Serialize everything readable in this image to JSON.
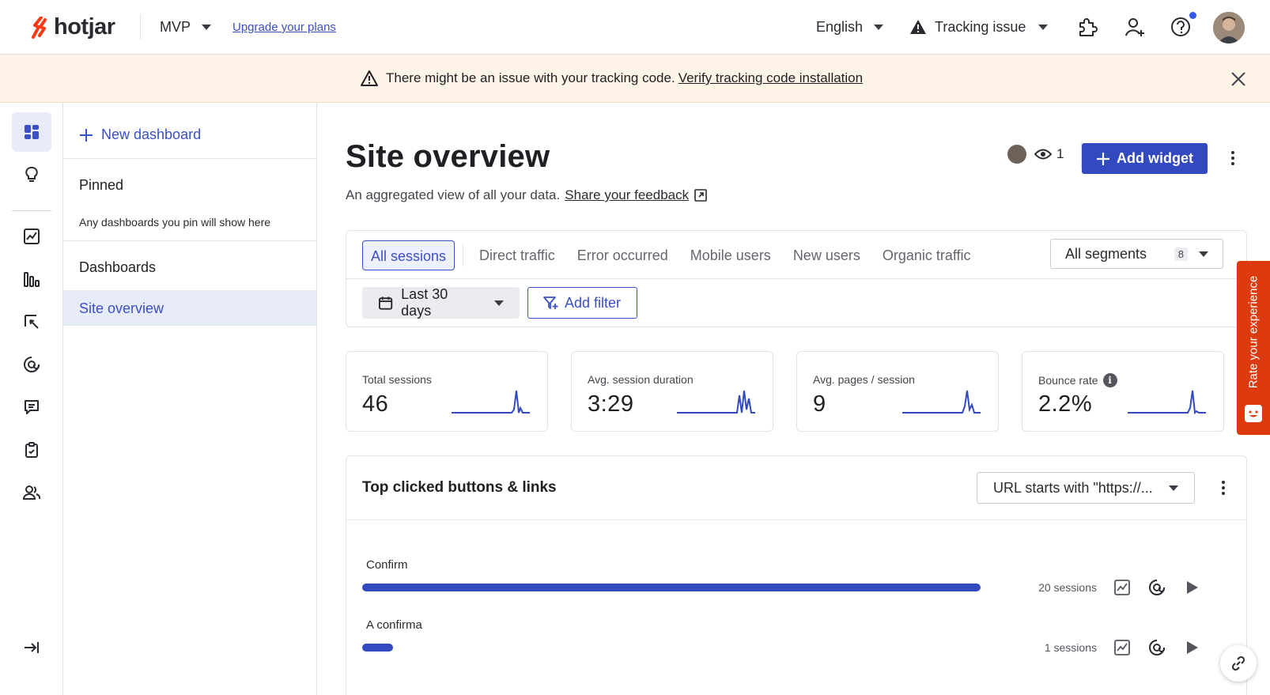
{
  "app": {
    "logo_text": "hotjar",
    "brand_color": "#fd3a16",
    "accent_color": "#3249c0"
  },
  "header": {
    "project": "MVP",
    "upgrade_link": "Upgrade your plans",
    "language": "English",
    "tracking": "Tracking issue",
    "icons": [
      "puzzle-icon",
      "add-user-icon",
      "help-icon",
      "avatar"
    ]
  },
  "banner": {
    "message": "There might be an issue with your tracking code.",
    "link": "Verify tracking code installation"
  },
  "rail": {
    "items": [
      "dashboard-icon",
      "lightbulb-icon",
      "trends-icon",
      "funnels-icon",
      "heatmaps-icon",
      "recordings-icon",
      "feedback-icon",
      "surveys-icon",
      "interviews-icon"
    ],
    "collapse_icon": "collapse-icon"
  },
  "panel": {
    "new_dashboard": "New dashboard",
    "pinned_heading": "Pinned",
    "pinned_note": "Any dashboards you pin will show here",
    "dashboards_heading": "Dashboards",
    "dashboards": [
      "Site overview"
    ]
  },
  "main": {
    "title": "Site overview",
    "subtitle": "An aggregated view of all your data.",
    "feedback_link": "Share your feedback",
    "viewer_count": "1",
    "add_widget": "Add widget"
  },
  "filters": {
    "tabs": [
      "All sessions",
      "Direct traffic",
      "Error occurred",
      "Mobile users",
      "New users",
      "Organic traffic"
    ],
    "active_tab": "All sessions",
    "segments_label": "All segments",
    "segments_count": "8",
    "date_range": "Last 30 days",
    "add_filter": "Add filter"
  },
  "stats": [
    {
      "label": "Total sessions",
      "value": "46"
    },
    {
      "label": "Avg. session duration",
      "value": "3:29"
    },
    {
      "label": "Avg. pages / session",
      "value": "9"
    },
    {
      "label": "Bounce rate",
      "value": "2.2%"
    }
  ],
  "widget": {
    "title": "Top clicked buttons & links",
    "url_filter": "URL starts with \"https://...",
    "rows": [
      {
        "label": "Confirm",
        "sessions": "20 sessions",
        "fraction": 1.0
      },
      {
        "label": "A confirma",
        "sessions": "1 sessions",
        "fraction": 0.05
      }
    ]
  },
  "feedback_tab": {
    "label": "Rate your experience"
  }
}
